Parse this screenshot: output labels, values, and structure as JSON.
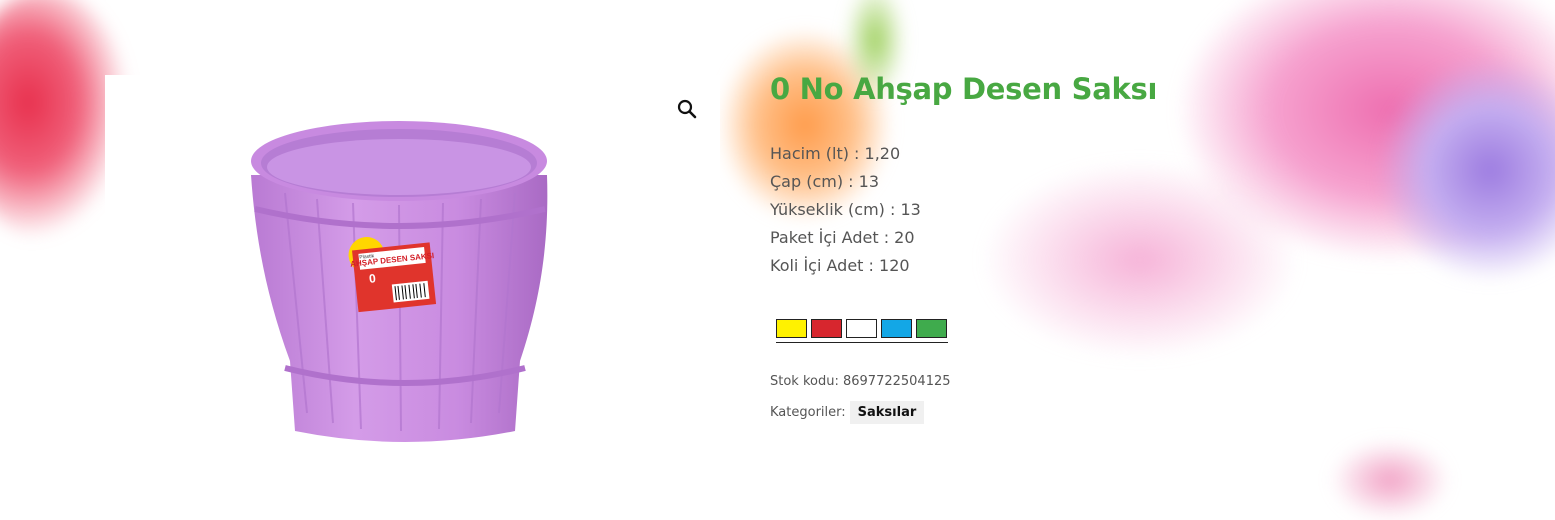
{
  "product": {
    "title": "0 No Ahşap Desen Saksı",
    "specs": [
      "Hacim (lt) : 1,20",
      "Çap (cm) : 13",
      "Yükseklik (cm) : 13",
      "Paket İçi Adet : 20",
      "Koli İçi Adet : 120"
    ],
    "colors": [
      "#fff200",
      "#d7262e",
      "#ffffff",
      "#13a7e6",
      "#3fab4d"
    ],
    "sku_text": "Stok kodu: 8697722504125",
    "categories_label": "Kategoriler:",
    "category": "Saksılar",
    "image_label": {
      "brand": "Plastik",
      "name": "AHŞAP DESEN SAKSI",
      "number": "0"
    }
  },
  "icons": {
    "zoom": "magnifier-icon"
  },
  "theme": {
    "title_color": "#48a842",
    "pot_color": "#c98be0"
  }
}
